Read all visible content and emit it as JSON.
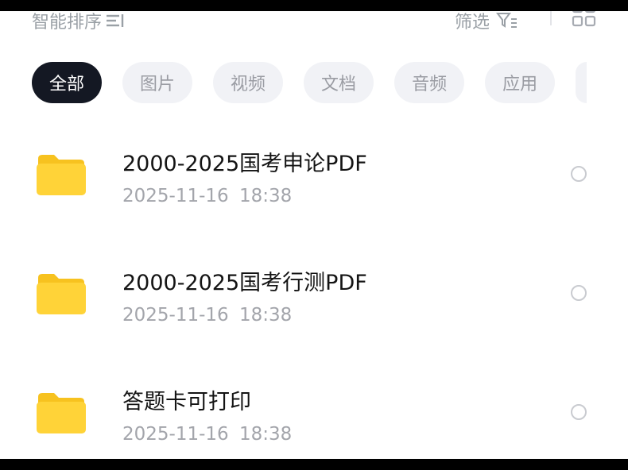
{
  "toolbar": {
    "sort_label": "智能排序",
    "sort_icon": "sort-lines-icon",
    "filter_label": "筛选",
    "filter_icon": "filter-funnel-icon",
    "view_icon": "grid-view-icon"
  },
  "tabs": [
    {
      "label": "全部",
      "active": true
    },
    {
      "label": "图片",
      "active": false
    },
    {
      "label": "视频",
      "active": false
    },
    {
      "label": "文档",
      "active": false
    },
    {
      "label": "音频",
      "active": false
    },
    {
      "label": "应用",
      "active": false
    }
  ],
  "files": [
    {
      "name": "2000-2025国考申论PDF",
      "date": "2025-11-16",
      "time": "18:38",
      "type": "folder",
      "selected": false
    },
    {
      "name": "2000-2025国考行测PDF",
      "date": "2025-11-16",
      "time": "18:38",
      "type": "folder",
      "selected": false
    },
    {
      "name": "答题卡可打印",
      "date": "2025-11-16",
      "time": "18:38",
      "type": "folder",
      "selected": false
    }
  ],
  "colors": {
    "active_tab_bg": "#141823",
    "inactive_tab_bg": "#f1f2f6",
    "folder_yellow": "#ffd338",
    "folder_back": "#f7c21f"
  }
}
